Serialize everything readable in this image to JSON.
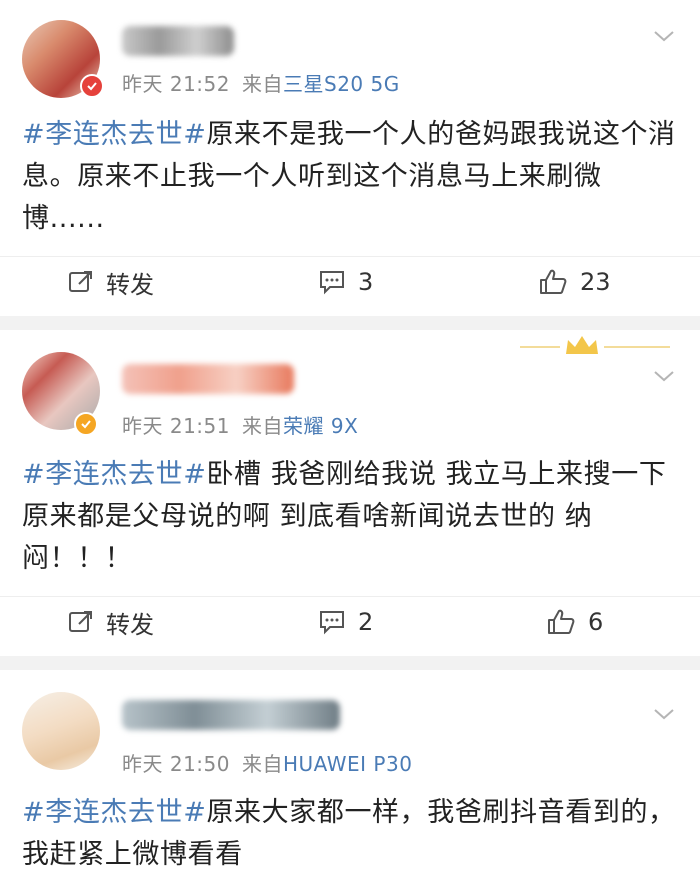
{
  "posts": [
    {
      "time": "昨天 21:52",
      "source_prefix": "来自",
      "source": "三星S20 5G",
      "hashtag": "#李连杰去世#",
      "text": "原来不是我一个人的爸妈跟我说这个消息。原来不止我一个人听到这个消息马上来刷微博......",
      "actions": {
        "repost": "转发",
        "comments": "3",
        "likes": "23"
      }
    },
    {
      "time": "昨天 21:51",
      "source_prefix": "来自",
      "source": "荣耀 9X",
      "hashtag": "#李连杰去世#",
      "text": "卧槽  我爸刚给我说  我立马上来搜一下  原来都是父母说的啊  到底看啥新闻说去世的  纳闷！！！",
      "actions": {
        "repost": "转发",
        "comments": "2",
        "likes": "6"
      }
    },
    {
      "time": "昨天 21:50",
      "source_prefix": "来自",
      "source": "HUAWEI P30",
      "hashtag": "#李连杰去世#",
      "text": "原来大家都一样，我爸刷抖音看到的，我赶紧上微博看看"
    }
  ],
  "icons": {
    "repost": "repost-icon",
    "comment": "comment-icon",
    "like": "thumbs-up-icon",
    "more": "chevron-down-icon",
    "decoration": "crown-icon"
  },
  "colors": {
    "link": "#4a7bb5",
    "meta": "#8a8a8a",
    "text": "#222222",
    "separator": "#f2f2f2"
  }
}
